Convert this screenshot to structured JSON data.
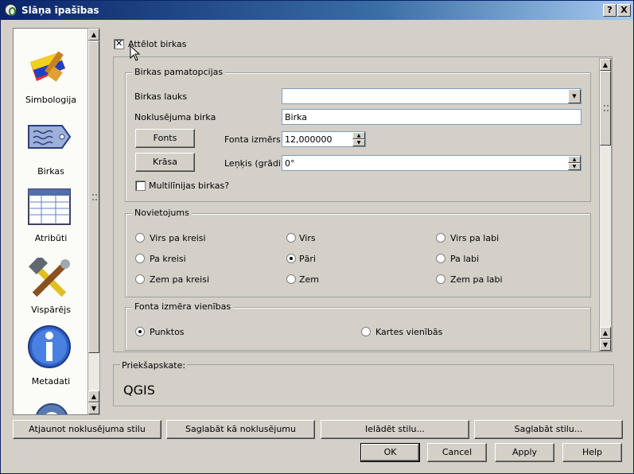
{
  "window": {
    "title": "Slāņa īpašības"
  },
  "titlebar_buttons": {
    "help": "?",
    "close": "X"
  },
  "sidebar": {
    "items": [
      {
        "label": "Simbologija"
      },
      {
        "label": "Birkas"
      },
      {
        "label": "Atribūti"
      },
      {
        "label": "Vispārējs"
      },
      {
        "label": "Metadati"
      }
    ]
  },
  "show_labels": {
    "label": "Attēlot birkas",
    "checked": true
  },
  "basic": {
    "title": "Birkas pamatopcijas",
    "field_label": "Birkas lauks",
    "field_value": "",
    "default_label": "Noklusējuma birka",
    "default_value": "Birka",
    "fonts_button": "Fonts",
    "font_size_label": "Fonta izmērs",
    "font_size_value": "12,000000",
    "color_button": "Krāsa",
    "angle_label": "Leņķis (grādi)",
    "angle_value": "0°",
    "multiline_label": "Multilīnijas birkas?"
  },
  "placement": {
    "title": "Novietojums",
    "options": [
      "Virs pa kreisi",
      "Virs",
      "Virs pa labi",
      "Pa kreisi",
      "Pāri",
      "Pa labi",
      "Zem pa kreisi",
      "Zem",
      "Zem pa labi"
    ],
    "selected": "Pāri"
  },
  "units": {
    "title": "Fonta izmēra vienības",
    "options": [
      "Punktos",
      "Kartes vienībās"
    ],
    "selected": "Punktos"
  },
  "preview": {
    "title": "Priekšapskate:",
    "text": "QGIS"
  },
  "style_buttons": {
    "restore": "Atjaunot noklusējuma stilu",
    "save_default": "Saglabāt kā noklusējumu",
    "load": "Ielādēt stilu...",
    "save": "Saglabāt stilu..."
  },
  "dialog_buttons": {
    "ok": "OK",
    "cancel": "Cancel",
    "apply": "Apply",
    "help": "Help"
  },
  "icons": [
    "qgis-icon",
    "symbology-icon",
    "label-tag-icon",
    "attribute-table-icon",
    "tools-icon",
    "info-icon",
    "gear-icon",
    "mouse-cursor-icon"
  ]
}
